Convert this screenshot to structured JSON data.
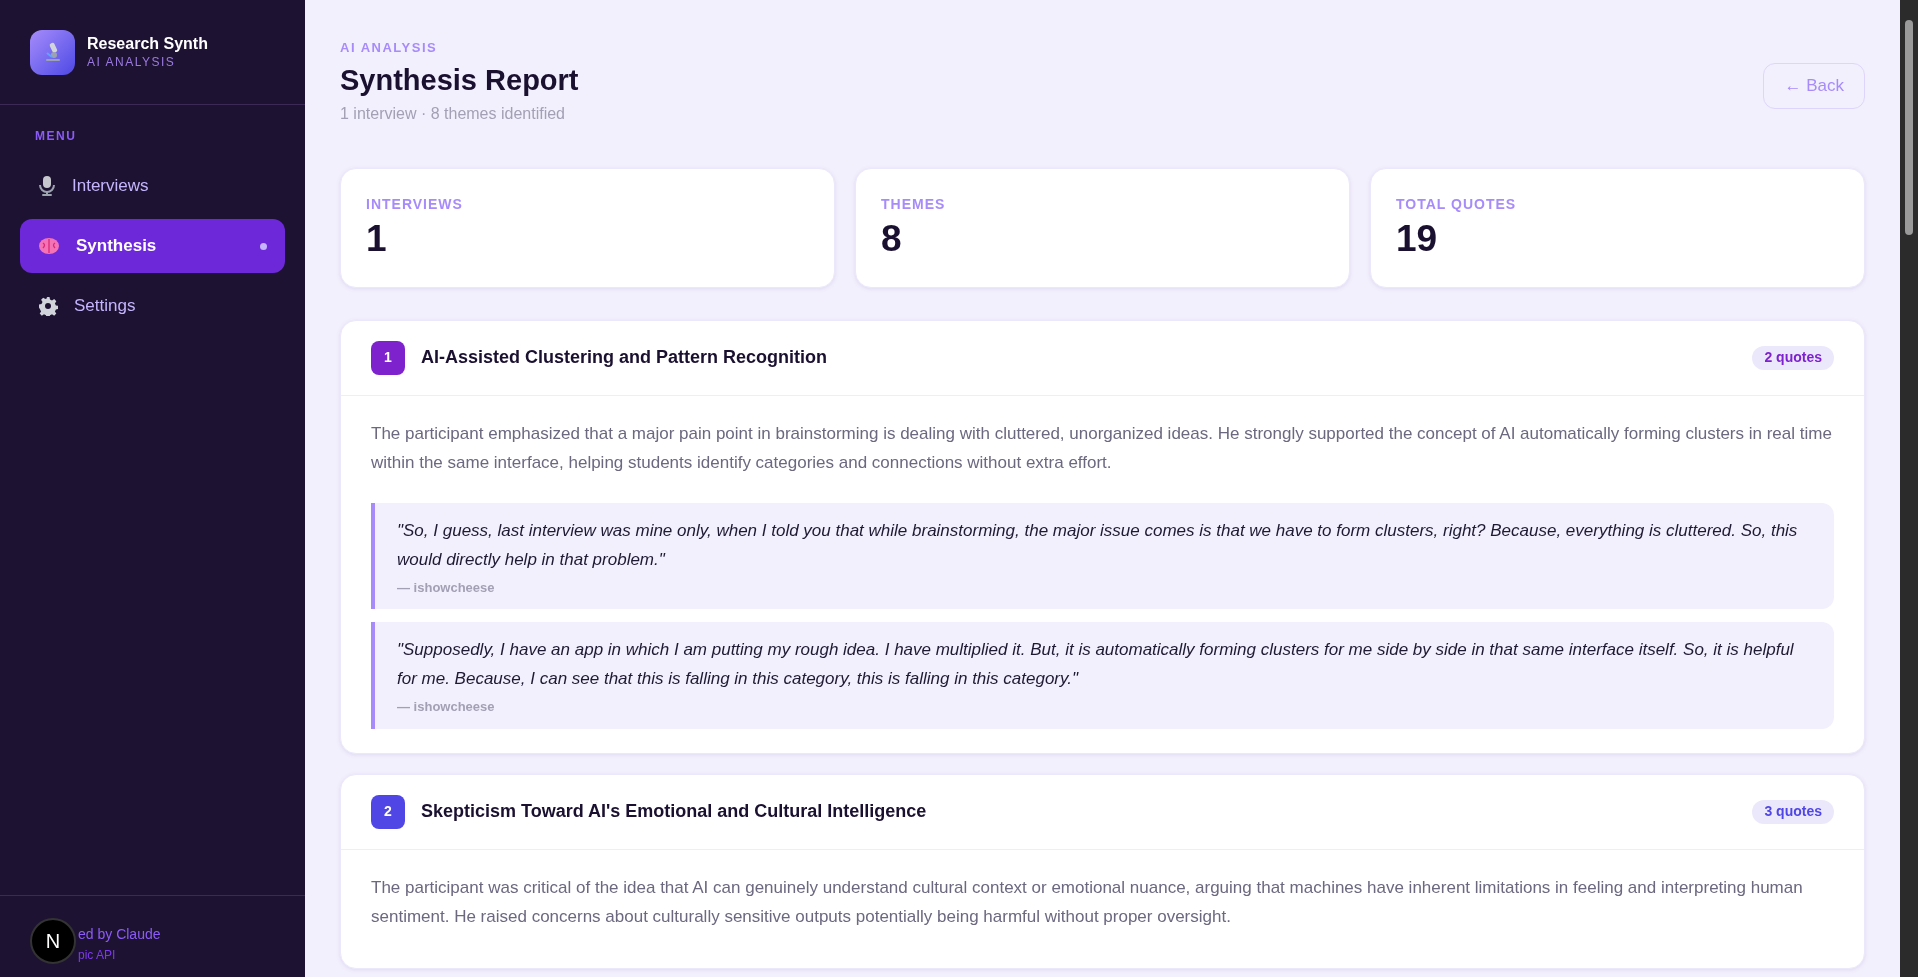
{
  "sidebar": {
    "brand": {
      "title": "Research Synth",
      "subtitle": "AI ANALYSIS"
    },
    "menu_label": "MENU",
    "items": [
      {
        "label": "Interviews",
        "selected": false
      },
      {
        "label": "Synthesis",
        "selected": true
      },
      {
        "label": "Settings",
        "selected": false
      }
    ],
    "footer": {
      "line_1": "ed by Claude",
      "line_2": "pic API",
      "badge": "N"
    }
  },
  "header": {
    "eyebrow": "AI ANALYSIS",
    "title": "Synthesis Report",
    "subtitle": "1 interview · 8 themes identified",
    "back_button": "← Back"
  },
  "stats": [
    {
      "label": "INTERVIEWS",
      "value": "1"
    },
    {
      "label": "THEMES",
      "value": "8"
    },
    {
      "label": "TOTAL QUOTES",
      "value": "19"
    }
  ],
  "themes": [
    {
      "number": "1",
      "title": "AI-Assisted Clustering and Pattern Recognition",
      "count": "2 quotes",
      "color": "#7e22ce",
      "summary": "The participant emphasized that a major pain point in brainstorming is dealing with cluttered, unorganized ideas. He strongly supported the concept of AI automatically forming clusters in real time within the same interface, helping students identify categories and connections without extra effort.",
      "quotes": [
        {
          "text": "\"So, I guess, last interview was mine only, when I told you that while brainstorming, the major issue comes is that we have to form clusters, right? Because, everything is cluttered. So, this would directly help in that problem.\"",
          "author": "— ishowcheese"
        },
        {
          "text": "\"Supposedly, I have an app in which I am putting my rough idea. I have multiplied it. But, it is automatically forming clusters for me side by side in that same interface itself. So, it is helpful for me. Because, I can see that this is falling in this category, this is falling in this category.\"",
          "author": "— ishowcheese"
        }
      ]
    },
    {
      "number": "2",
      "title": "Skepticism Toward AI's Emotional and Cultural Intelligence",
      "count": "3 quotes",
      "color": "#4f46e5",
      "summary": "The participant was critical of the idea that AI can genuinely understand cultural context or emotional nuance, arguing that machines have inherent limitations in feeling and interpreting human sentiment. He raised concerns about culturally sensitive outputs potentially being harmful without proper oversight."
    }
  ]
}
